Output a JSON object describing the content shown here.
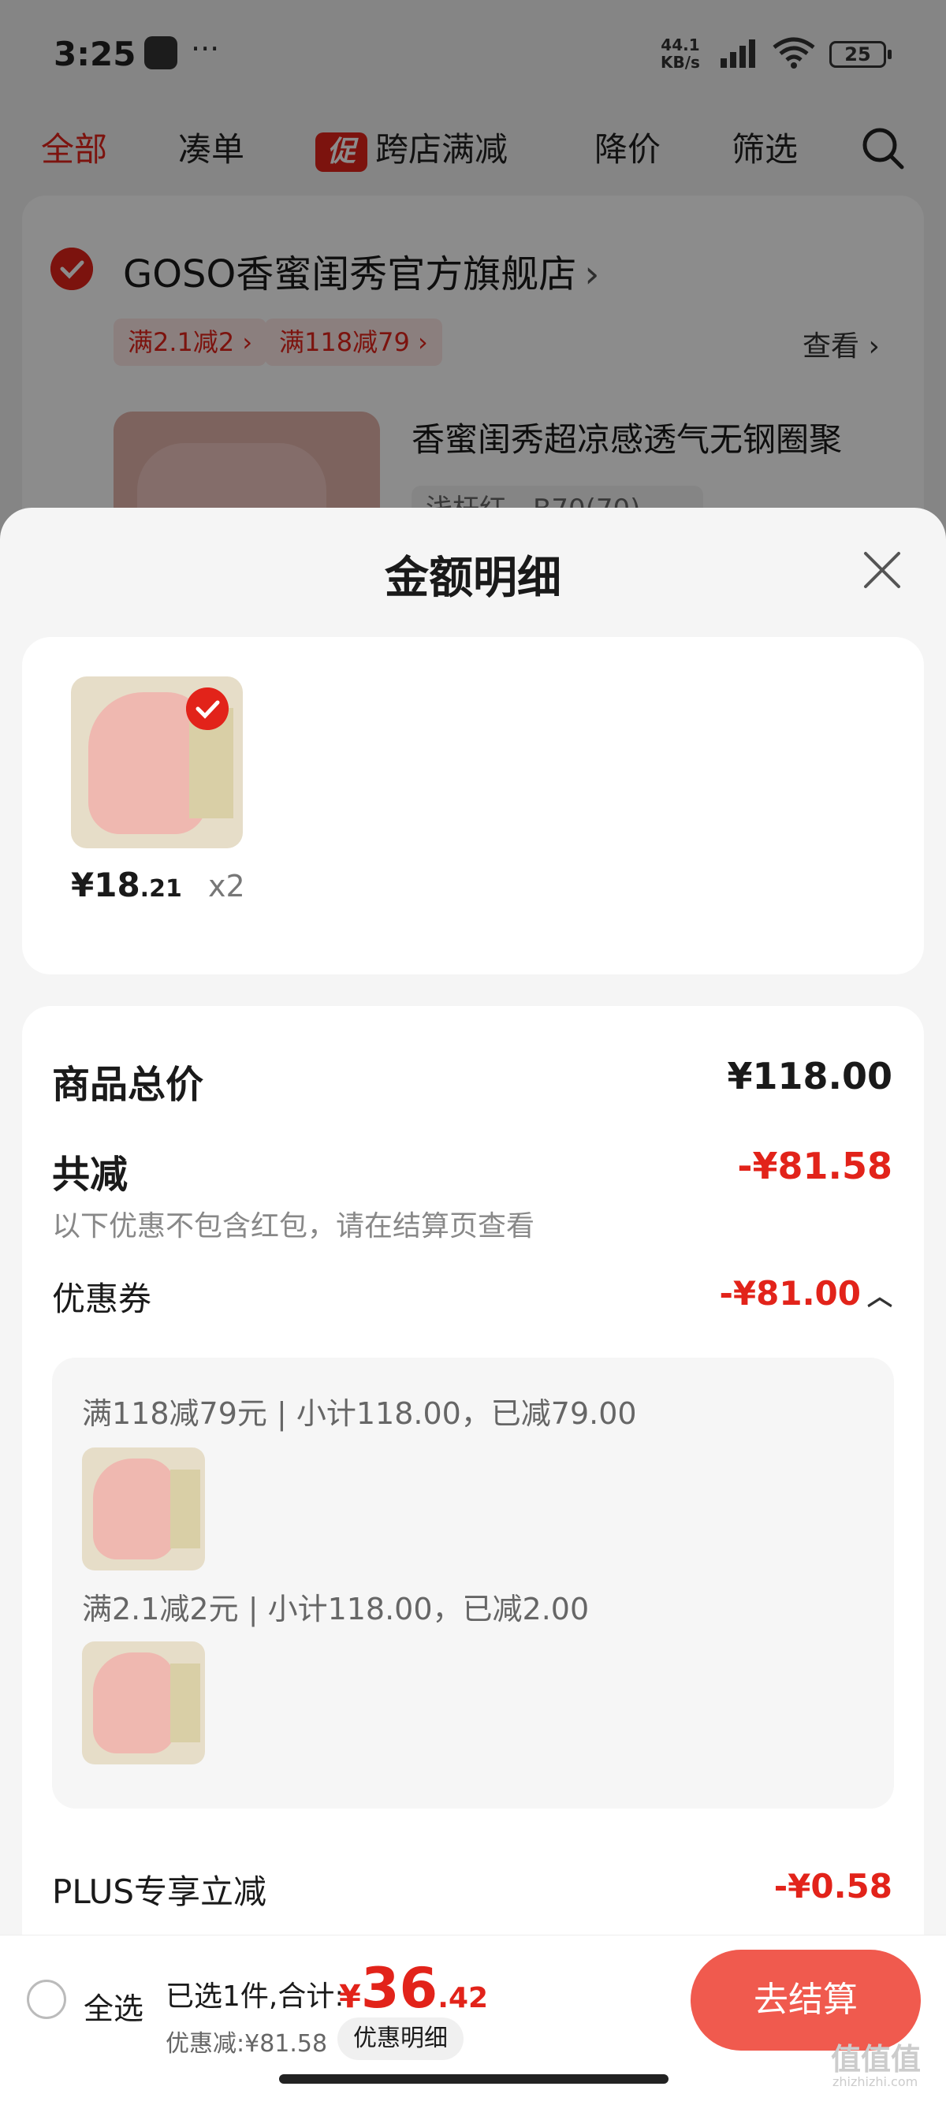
{
  "status_bar": {
    "time": "3:25",
    "dots": "···",
    "speed_top": "44.1",
    "speed_bottom": "KB/s",
    "battery": "25"
  },
  "tabs": [
    {
      "label": "全部"
    },
    {
      "label": "凑单"
    },
    {
      "label": "跨店满减",
      "badge": "促"
    },
    {
      "label": "降价"
    },
    {
      "label": "筛选"
    }
  ],
  "store": {
    "name": "GOSO香蜜闺秀官方旗舰店",
    "tags": [
      "满2.1减2 ›",
      "满118减79 ›"
    ],
    "view_more": "查看 ›",
    "product_title": "香蜜闺秀超凉感透气无钢圈聚",
    "product_spec": "浅杆红，B70(70)"
  },
  "sheet": {
    "title": "金额明细",
    "item": {
      "price_int": "¥18",
      "price_dec": ".21",
      "qty": "x2"
    },
    "total_label": "商品总价",
    "total_value": "¥118.00",
    "reduce_label": "共减",
    "reduce_value": "-¥81.58",
    "reduce_note": "以下优惠不包含红包，请在结算页查看",
    "coupon_label": "优惠券",
    "coupon_value": "-¥81.00",
    "coupon_lines": [
      "满118减79元 | 小计118.00，已减79.00",
      "满2.1减2元 | 小计118.00，已减2.00"
    ],
    "plus_label": "PLUS专享立减",
    "plus_value": "-¥0.58"
  },
  "bottom": {
    "select_all": "全选",
    "selected_summary": "已选1件,合计:",
    "total_currency": "¥",
    "total_int": "36",
    "total_dec": ".42",
    "discount_text": "优惠减:¥81.58",
    "detail_pill": "优惠明细",
    "checkout": "去结算"
  },
  "watermark": {
    "main": "值值值",
    "sub": "zhizhizhi.com"
  },
  "colors": {
    "accent": "#e2231a",
    "checkout": "#f05a4e"
  }
}
